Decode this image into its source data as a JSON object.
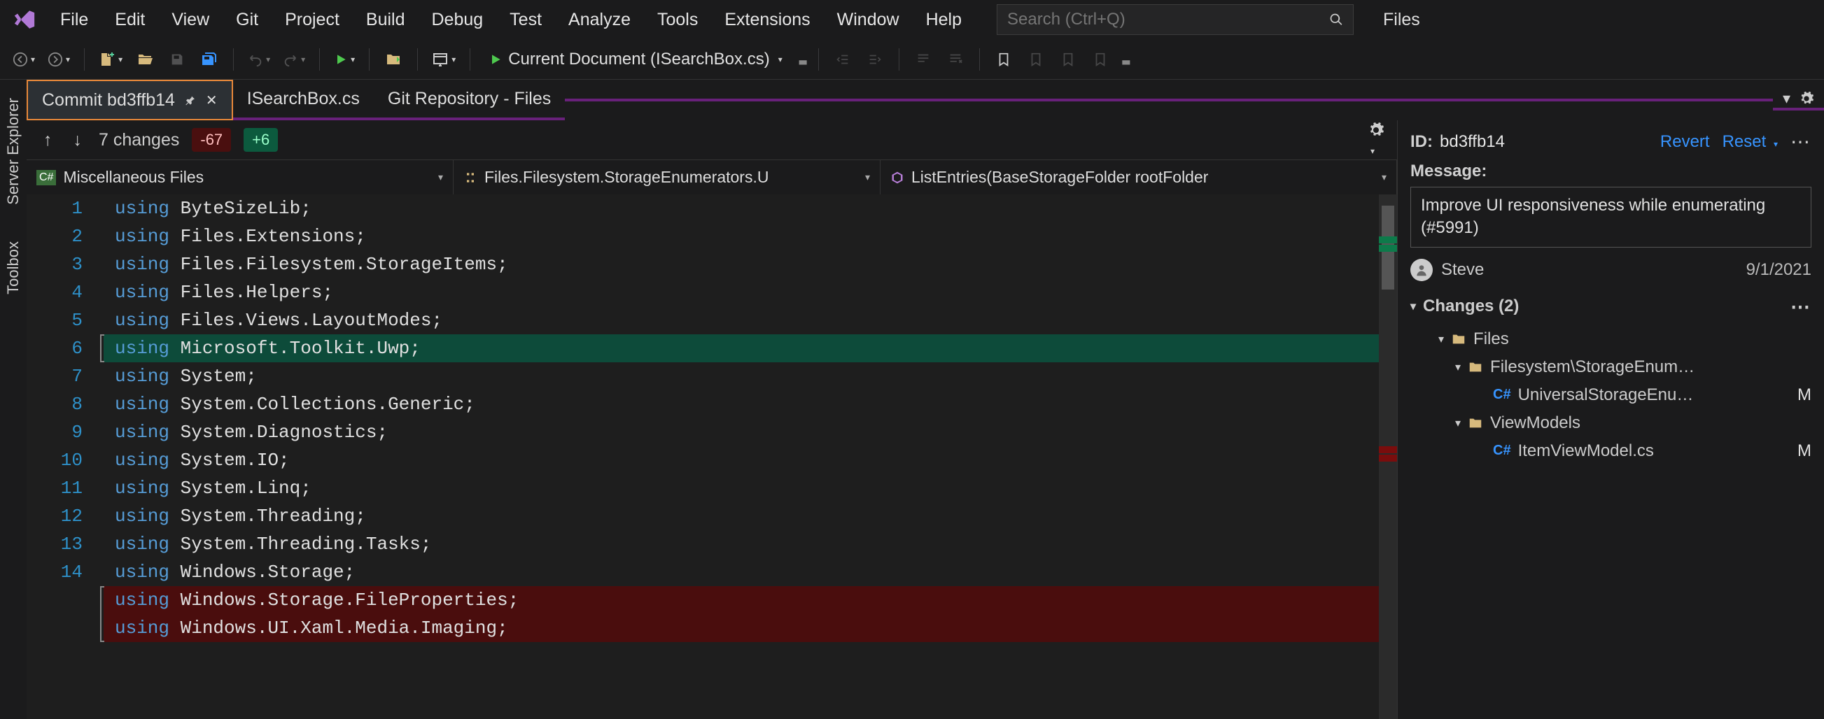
{
  "menu": [
    "File",
    "Edit",
    "View",
    "Git",
    "Project",
    "Build",
    "Debug",
    "Test",
    "Analyze",
    "Tools",
    "Extensions",
    "Window",
    "Help"
  ],
  "search": {
    "placeholder": "Search (Ctrl+Q)"
  },
  "titleRight": "Files",
  "toolbar": {
    "current_doc": "Current Document (ISearchBox.cs)"
  },
  "doc_tabs": [
    {
      "label": "Commit bd3ffb14",
      "active": true,
      "pinned": true,
      "closable": true
    },
    {
      "label": "ISearchBox.cs",
      "active": false
    },
    {
      "label": "Git Repository - Files",
      "active": false
    }
  ],
  "changes_bar": {
    "summary": "7 changes",
    "deletions": "-67",
    "additions": "+6"
  },
  "crumbs": {
    "c1": "Miscellaneous Files",
    "c2": "Files.Filesystem.StorageEnumerators.U",
    "c3": "ListEntries(BaseStorageFolder rootFolder"
  },
  "code": {
    "lines": [
      {
        "n": 1,
        "kw": "using",
        "rest": " ByteSizeLib;"
      },
      {
        "n": 2,
        "kw": "using",
        "rest": " Files.Extensions;"
      },
      {
        "n": 3,
        "kw": "using",
        "rest": " Files.Filesystem.StorageItems;"
      },
      {
        "n": 4,
        "kw": "using",
        "rest": " Files.Helpers;"
      },
      {
        "n": 5,
        "kw": "using",
        "rest": " Files.Views.LayoutModes;"
      },
      {
        "n": 6,
        "kw": "using",
        "rest": " Microsoft.Toolkit.Uwp;",
        "state": "added"
      },
      {
        "n": 7,
        "kw": "using",
        "rest": " System;"
      },
      {
        "n": 8,
        "kw": "using",
        "rest": " System.Collections.Generic;"
      },
      {
        "n": 9,
        "kw": "using",
        "rest": " System.Diagnostics;"
      },
      {
        "n": 10,
        "kw": "using",
        "rest": " System.IO;"
      },
      {
        "n": 11,
        "kw": "using",
        "rest": " System.Linq;"
      },
      {
        "n": 12,
        "kw": "using",
        "rest": " System.Threading;"
      },
      {
        "n": 13,
        "kw": "using",
        "rest": " System.Threading.Tasks;"
      },
      {
        "n": 14,
        "kw": "using",
        "rest": " Windows.Storage;"
      },
      {
        "n": "",
        "kw": "using",
        "rest": " Windows.Storage.FileProperties;",
        "state": "deleted"
      },
      {
        "n": "",
        "kw": "using",
        "rest": " Windows.UI.Xaml.Media.Imaging;",
        "state": "deleted"
      }
    ]
  },
  "right": {
    "id_label": "ID:",
    "id_value": "bd3ffb14",
    "revert": "Revert",
    "reset": "Reset",
    "message_label": "Message:",
    "message": "Improve UI responsiveness while enumerating (#5991)",
    "author": "Steve",
    "date": "9/1/2021",
    "changes_header": "Changes (2)",
    "tree": {
      "root": "Files",
      "folder1": "Filesystem\\StorageEnum…",
      "file1": "UniversalStorageEnu…",
      "folder2": "ViewModels",
      "file2": "ItemViewModel.cs",
      "mod_flag": "M"
    }
  },
  "side_tabs": [
    "Server Explorer",
    "Toolbox"
  ]
}
